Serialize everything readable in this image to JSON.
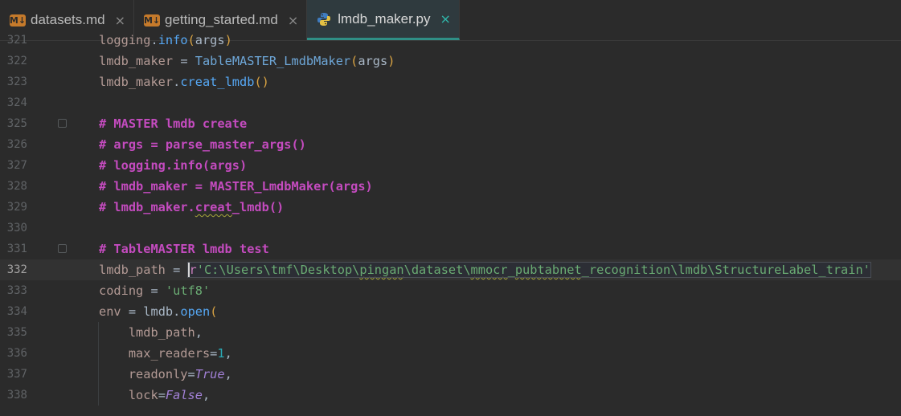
{
  "tabs": [
    {
      "label": "datasets.md",
      "icon": "markdown-icon",
      "active": false
    },
    {
      "label": "getting_started.md",
      "icon": "markdown-icon",
      "active": false
    },
    {
      "label": "lmdb_maker.py",
      "icon": "python-icon",
      "active": true
    }
  ],
  "tab_icon_text": "M↓",
  "close_glyph": "×",
  "lines": [
    {
      "n": "321",
      "text": "logging.info(args)"
    },
    {
      "n": "322",
      "text": "lmdb_maker = TableMASTER_LmdbMaker(args)"
    },
    {
      "n": "323",
      "text": "lmdb_maker.creat_lmdb()"
    },
    {
      "n": "324",
      "text": ""
    },
    {
      "n": "325",
      "text": "# MASTER lmdb create"
    },
    {
      "n": "326",
      "text": "# args = parse_master_args()"
    },
    {
      "n": "327",
      "text": "# logging.info(args)"
    },
    {
      "n": "328",
      "text": "# lmdb_maker = MASTER_LmdbMaker(args)"
    },
    {
      "n": "329",
      "text": "# lmdb_maker.creat_lmdb()"
    },
    {
      "n": "330",
      "text": ""
    },
    {
      "n": "331",
      "text": "# TableMASTER lmdb test"
    },
    {
      "n": "332",
      "text": "lmdb_path = r'C:\\Users\\tmf\\Desktop\\pingan\\dataset\\mmocr_pubtabnet_recognition\\lmdb\\StructureLabel_train'"
    },
    {
      "n": "333",
      "text": "coding = 'utf8'"
    },
    {
      "n": "334",
      "text": "env = lmdb.open("
    },
    {
      "n": "335",
      "text": "    lmdb_path,"
    },
    {
      "n": "336",
      "text": "    max_readers=1,"
    },
    {
      "n": "337",
      "text": "    readonly=True,"
    },
    {
      "n": "338",
      "text": "    lock=False,"
    }
  ],
  "current_line": "332",
  "colors": {
    "background": "#2b2b2b",
    "accent": "#2f8f86",
    "comment": "#c44bbf",
    "string": "#6aab73"
  }
}
